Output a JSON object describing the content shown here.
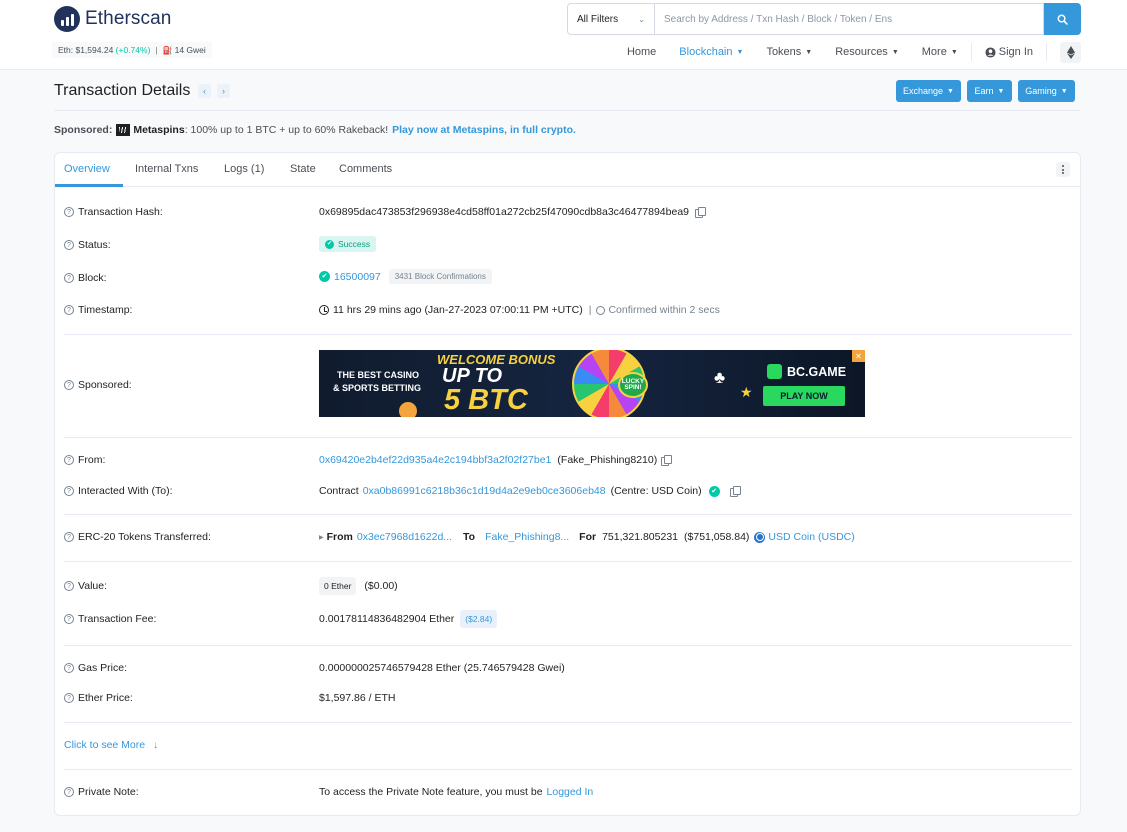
{
  "brand": {
    "name": "Etherscan"
  },
  "price_bar": {
    "eth_label": "Eth: $1,594.24",
    "eth_change": "(+0.74%)",
    "separator": "|",
    "gas": "14 Gwei"
  },
  "search": {
    "filter": "All Filters",
    "placeholder": "Search by Address / Txn Hash / Block / Token / Ens"
  },
  "nav": {
    "home": "Home",
    "blockchain": "Blockchain",
    "tokens": "Tokens",
    "resources": "Resources",
    "more": "More",
    "sign_in": "Sign In"
  },
  "page": {
    "title": "Transaction Details"
  },
  "top_buttons": {
    "exchange": "Exchange",
    "earn": "Earn",
    "gaming": "Gaming"
  },
  "sponsor_bar": {
    "label": "Sponsored:",
    "brand": "Metaspins",
    "text": ": 100% up to 1 BTC + up to 60% Rakeback!",
    "cta": "Play now at Metaspins, in full crypto."
  },
  "tabs": {
    "overview": "Overview",
    "internal": "Internal Txns",
    "logs": "Logs (1)",
    "state": "State",
    "comments": "Comments"
  },
  "rows": {
    "hash": {
      "label": "Transaction Hash:",
      "value": "0x69895dac473853f296938e4cd58ff01a272cb25f47090cdb8a3c46477894bea9"
    },
    "status": {
      "label": "Status:",
      "value": "Success"
    },
    "block": {
      "label": "Block:",
      "value": "16500097",
      "confirmations": "3431 Block Confirmations"
    },
    "timestamp": {
      "label": "Timestamp:",
      "value": "11 hrs 29 mins ago (Jan-27-2023 07:00:11 PM +UTC)",
      "separator": "|",
      "confirmed": "Confirmed within 2 secs"
    },
    "sponsored": {
      "label": "Sponsored:"
    },
    "from": {
      "label": "From:",
      "address": "0x69420e2b4ef22d935a4e2c194bbf3a2f02f27be1",
      "tag": "(Fake_Phishing8210)"
    },
    "to": {
      "label": "Interacted With (To):",
      "prefix": "Contract",
      "address": "0xa0b86991c6218b36c1d19d4a2e9eb0ce3606eb48",
      "tag": "(Centre: USD Coin)"
    },
    "erc20": {
      "label": "ERC-20 Tokens Transferred:",
      "from_label": "From",
      "from_addr": "0x3ec7968d1622d...",
      "to_label": "To",
      "to_addr": "Fake_Phishing8...",
      "for_label": "For",
      "amount": "751,321.805231",
      "usd": "($751,058.84)",
      "token": "USD Coin (USDC)"
    },
    "value": {
      "label": "Value:",
      "amount": "0 Ether",
      "usd": "($0.00)"
    },
    "fee": {
      "label": "Transaction Fee:",
      "amount": "0.00178114836482904 Ether",
      "usd": "($2.84)"
    },
    "gas_price": {
      "label": "Gas Price:",
      "value": "0.000000025746579428 Ether (25.746579428 Gwei)"
    },
    "ether_price": {
      "label": "Ether Price:",
      "value": "$1,597.86 / ETH"
    },
    "more": {
      "label": "Click to see More"
    },
    "private_note": {
      "label": "Private Note:",
      "text": "To access the Private Note feature, you must be",
      "link": "Logged In"
    }
  },
  "ad": {
    "line1": "THE BEST CASINO",
    "line2": "& SPORTS BETTING",
    "welcome": "WELCOME BONUS",
    "up_to": "UP TO",
    "amount": "5 BTC",
    "wheel": "LUCKY SPIN!",
    "brand": "BC.GAME",
    "cta": "PLAY NOW",
    "close": "✕"
  }
}
